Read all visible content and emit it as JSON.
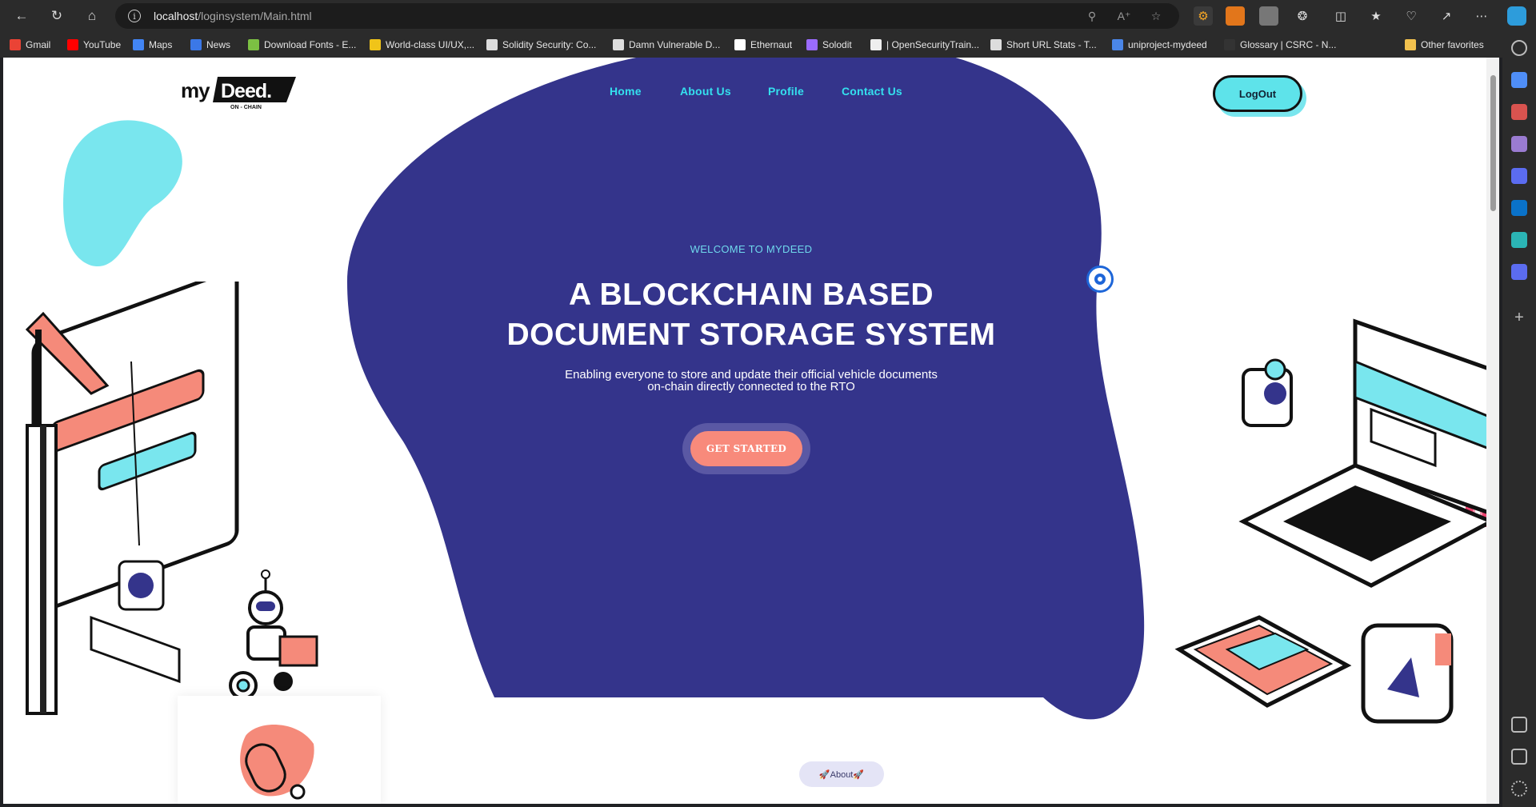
{
  "browser": {
    "url_host": "localhost",
    "url_path": "/loginsystem/Main.html",
    "bookmarks": [
      {
        "label": "Gmail",
        "icon": "gmail-icon",
        "color": "#ea4335"
      },
      {
        "label": "YouTube",
        "icon": "youtube-icon",
        "color": "#ff0000"
      },
      {
        "label": "Maps",
        "icon": "google-icon",
        "color": "#4285f4"
      },
      {
        "label": "News",
        "icon": "news-icon",
        "color": "#3b78e7"
      },
      {
        "label": "Download Fonts - E...",
        "icon": "leaf-icon",
        "color": "#7cc043"
      },
      {
        "label": "World-class UI/UX,...",
        "icon": "mountain-icon",
        "color": "#f0c419"
      },
      {
        "label": "Solidity Security: Co...",
        "icon": "key-icon",
        "color": "#dddddd"
      },
      {
        "label": "Damn Vulnerable D...",
        "icon": "page-icon",
        "color": "#dddddd"
      },
      {
        "label": "Ethernaut",
        "icon": "z-icon",
        "color": "#ffffff"
      },
      {
        "label": "Solodit",
        "icon": "solodit-icon",
        "color": "#9b6bff"
      },
      {
        "label": "| OpenSecurityTrain...",
        "icon": "ost-icon",
        "color": "#eeeeee"
      },
      {
        "label": "Short URL Stats - T...",
        "icon": "tree-icon",
        "color": "#dddddd"
      },
      {
        "label": "uniproject-mydeed",
        "icon": "doc-icon",
        "color": "#4a86e8"
      },
      {
        "label": "Glossary | CSRC - N...",
        "icon": "nist-icon",
        "color": "#333333"
      }
    ],
    "other_favorites": "Other favorites"
  },
  "site": {
    "logo_text": "myDeed.",
    "logo_tagline": "ON - CHAIN",
    "nav": [
      "Home",
      "About Us",
      "Profile",
      "Contact Us"
    ],
    "logout_label": "LogOut",
    "welcome": "WELCOME TO MYDEED",
    "title_line1": "A BLOCKCHAIN BASED",
    "title_line2": "DOCUMENT STORAGE SYSTEM",
    "subtitle_line1": "Enabling everyone to store and update their official vehicle documents",
    "subtitle_line2": "on-chain directly connected to the RTO",
    "cta_label": "GET STARTED",
    "about_pill": "🚀About🚀"
  },
  "colors": {
    "hero_blob": "#34348b",
    "accent_cyan": "#34e0ee",
    "cta": "#f88a7b",
    "coral": "#f58a7a"
  }
}
